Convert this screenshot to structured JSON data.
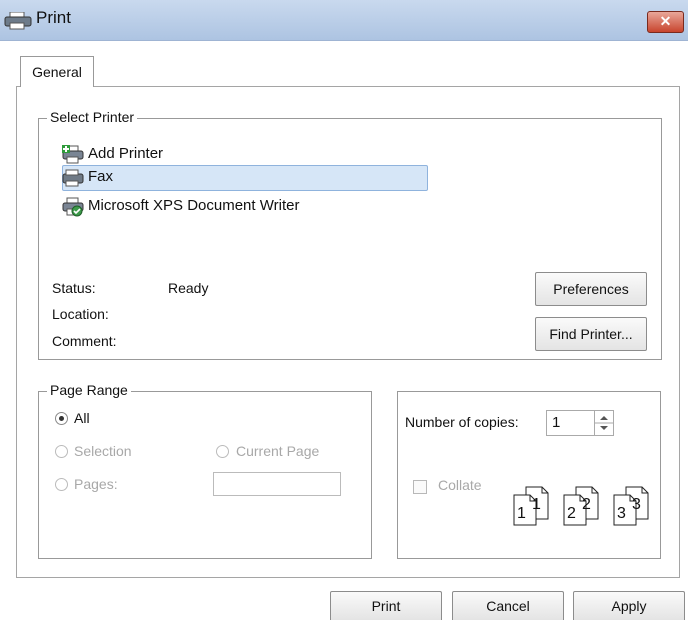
{
  "window": {
    "title": "Print",
    "close_glyph": "✕"
  },
  "tabs": [
    {
      "label": "General"
    }
  ],
  "select_printer": {
    "legend": "Select Printer",
    "printers": [
      {
        "label": "Add Printer",
        "icon": "add-printer-icon"
      },
      {
        "label": "Fax",
        "icon": "fax-printer-icon",
        "selected": true
      },
      {
        "label": "Microsoft XPS Document Writer",
        "icon": "xps-printer-icon"
      }
    ],
    "status_label": "Status:",
    "status_value": "Ready",
    "location_label": "Location:",
    "comment_label": "Comment:",
    "preferences_button": "Preferences",
    "find_printer_button": "Find Printer..."
  },
  "page_range": {
    "legend": "Page Range",
    "all": "All",
    "selection": "Selection",
    "current_page": "Current Page",
    "pages": "Pages:",
    "selected": "All"
  },
  "copies": {
    "number_label": "Number of copies:",
    "value": "1",
    "collate_label": "Collate",
    "collate_checked": false,
    "collate_page_numbers": [
      "1",
      "1",
      "2",
      "2",
      "3",
      "3"
    ]
  },
  "footer": {
    "print": "Print",
    "cancel": "Cancel",
    "apply": "Apply"
  }
}
